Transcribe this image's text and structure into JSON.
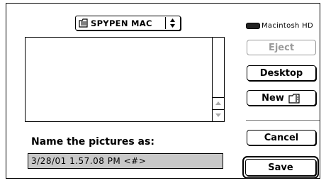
{
  "folder_popup": {
    "label": "SPYPEN MAC"
  },
  "disk": {
    "label": "Macintosh HD"
  },
  "buttons": {
    "eject": "Eject",
    "desktop": "Desktop",
    "new": "New",
    "cancel": "Cancel",
    "save": "Save"
  },
  "name_prompt": "Name the pictures as:",
  "name_field_value": "3/28/01 1.57.08 PM <#>",
  "icons": {
    "folder": "folder-icon",
    "popup_arrows": "up-down-arrows-icon",
    "disk": "hard-disk-icon",
    "new_folder": "new-folder-icon",
    "scroll_up": "scroll-up-arrow-icon",
    "scroll_down": "scroll-down-arrow-icon"
  }
}
